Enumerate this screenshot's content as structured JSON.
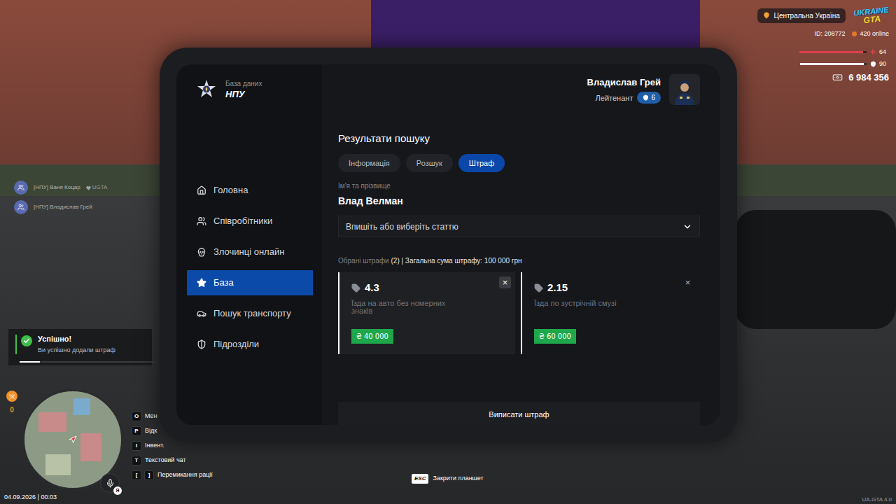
{
  "hud": {
    "region": "Центральна Україна",
    "logo": {
      "line1": "UKRAINE",
      "line2": "GTA"
    },
    "player_id": "ID: 208772",
    "online": "420 online",
    "health": {
      "value": "64",
      "level": 0.95
    },
    "armor": {
      "value": "90",
      "level": 0.95
    },
    "money": "6 984 356"
  },
  "chat": [
    {
      "text": "[НПУ] Ваня Коцар",
      "badge": "UGTA"
    },
    {
      "text": "[НПУ] Владислав Грей"
    }
  ],
  "toast": {
    "title": "Успішно!",
    "message": "Ви успішно додали штраф",
    "level": 0.15
  },
  "status": {
    "counter": "0",
    "mic_key": "Я",
    "datetime": "04.09.2026 | 00:03",
    "version": "UA-GTA 4.0"
  },
  "key_hints": [
    {
      "keys": [
        "O"
      ],
      "label": "Мен"
    },
    {
      "keys": [
        "P"
      ],
      "label": "Відк"
    },
    {
      "keys": [
        "I"
      ],
      "label": "Інвент."
    },
    {
      "keys": [
        "T"
      ],
      "label": "Текстовий чат"
    },
    {
      "keys": [
        "[",
        "]"
      ],
      "label": "Перемикання рації"
    }
  ],
  "close_hint": {
    "key": "ESC",
    "label": "Закрити планшет"
  },
  "tablet": {
    "brand": {
      "caption": "База даних",
      "name": "НПУ"
    },
    "user": {
      "name": "Владислав Грей",
      "rank": "Лейтенант",
      "level": "6"
    },
    "sidebar": {
      "items": [
        {
          "label": "Головна",
          "selected": false
        },
        {
          "label": "Співробітники",
          "selected": false
        },
        {
          "label": "Злочинці онлайн",
          "selected": false
        },
        {
          "label": "База",
          "selected": true
        },
        {
          "label": "Пошук транспорту",
          "selected": false
        },
        {
          "label": "Підрозділи",
          "selected": false
        }
      ]
    },
    "content": {
      "title": "Результати пошуку",
      "tabs": [
        {
          "label": "Інформація",
          "selected": false
        },
        {
          "label": "Розшук",
          "selected": false
        },
        {
          "label": "Штраф",
          "selected": true
        }
      ],
      "name_label": "Ім'я та прізвище",
      "name": "Влад Велман",
      "article_select": {
        "placeholder": "Впишіть або виберіть статтю"
      },
      "summary": {
        "label": "Обрані штрафи",
        "details": "(2) | Загальна сума штрафу: 100 000 грн"
      },
      "fines": [
        {
          "code": "4.3",
          "description": "Їзда на авто без номерних знаків",
          "amount": "₴ 40 000",
          "hovered": true,
          "close": "×"
        },
        {
          "code": "2.15",
          "description": "Їзда по зустрічній смузі",
          "amount": "₴ 60 000",
          "hovered": false,
          "close": "×"
        }
      ],
      "submit": "Виписати штраф"
    }
  }
}
